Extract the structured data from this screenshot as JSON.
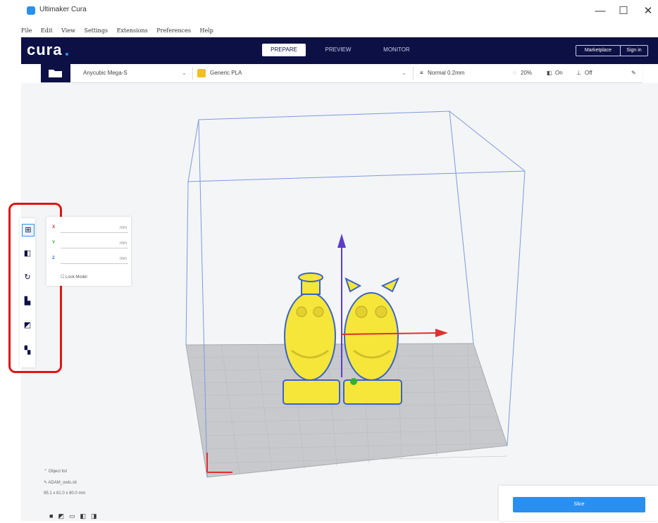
{
  "window": {
    "title": "Ultimaker Cura",
    "minimize": "—",
    "maximize": "☐",
    "close": "✕"
  },
  "menu": [
    "File",
    "Edit",
    "View",
    "Settings",
    "Extensions",
    "Preferences",
    "Help"
  ],
  "header": {
    "logo": "cura",
    "tabs": [
      {
        "label": "PREPARE",
        "active": true
      },
      {
        "label": "PREVIEW",
        "active": false
      },
      {
        "label": "MONITOR",
        "active": false
      }
    ],
    "marketplace_label": "Marketplace",
    "signin_label": "Sign in"
  },
  "config": {
    "printer": "Anycubic Mega-S",
    "material": "Generic PLA",
    "profile": "Normal 0.2mm",
    "infill": "20%",
    "support": "On",
    "adhesion": "Off"
  },
  "tool_panel": {
    "axes": [
      {
        "axis": "X",
        "unit": "mm"
      },
      {
        "axis": "Y",
        "unit": "mm"
      },
      {
        "axis": "Z",
        "unit": "mm"
      }
    ],
    "lock_label": "Lock Model"
  },
  "object_info": {
    "list_label": "Object list",
    "filename": "ADAM_owls.stl",
    "dimensions": "95.1 x 81.0 x 80.0 mm"
  },
  "action": {
    "slice_label": "Slice"
  },
  "colors": {
    "header": "#0c1044",
    "accent": "#2b8ff0",
    "model": "#f6e63a",
    "highlight": "#e01515"
  }
}
